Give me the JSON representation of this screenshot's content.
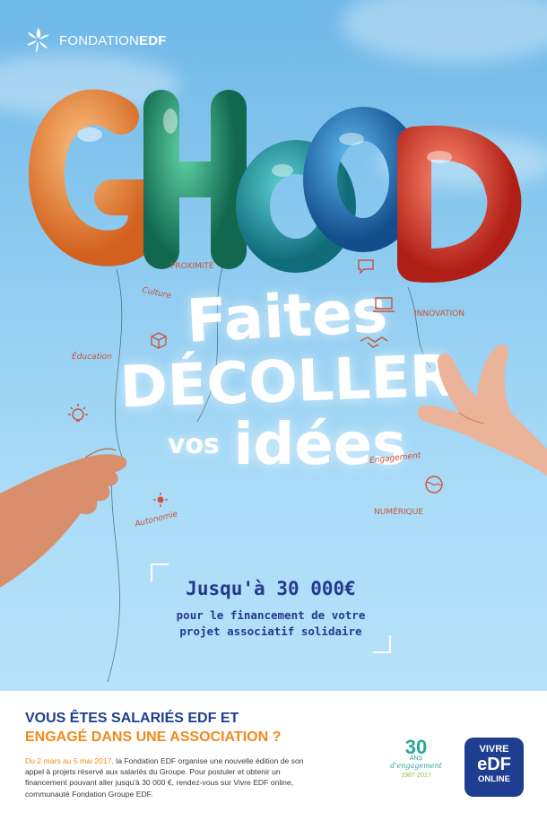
{
  "brand": {
    "logo_main": "FONDATION",
    "logo_accent": "EDF"
  },
  "headline": {
    "balloon_word": "GHOOD",
    "line1": "Faites",
    "line2": "DÉCOLLER",
    "line3_small": "vos",
    "line3_big": "idées"
  },
  "doodles": {
    "proximite": "PROXIMITÉ",
    "culture": "Culture",
    "innovation": "INNOVATION",
    "education": "Éducation",
    "engagement": "Engagement",
    "numerique": "NUMÉRIQUE",
    "autonomie": "Autonomie"
  },
  "offer": {
    "amount": "Jusqu'à 30 000€",
    "line1": "pour le financement de votre",
    "line2": "projet associatif solidaire"
  },
  "footer": {
    "title_line1": "VOUS ÊTES SALARIÉS EDF ET",
    "title_line2": "ENGAGÉ DANS UNE ASSOCIATION ?",
    "body_dates": "Du 2 mars au 5 mai 2017,",
    "body_text": " la Fondation EDF organise une nouvelle édition de son appel à projets réservé aux salariés du Groupe. Pour postuler et obtenir un financement pouvant aller jusqu'à 30 000 €, rendez-vous sur Vivre EDF online, communauté Fondation Groupe EDF."
  },
  "badge": {
    "number": "30",
    "ans": "ANS",
    "engagement": "d'engagement",
    "years": "1987-2017"
  },
  "vivre": {
    "line1": "VIVRE",
    "line2": "eDF",
    "line3": "ONLINE"
  },
  "colors": {
    "navy": "#1e3f8f",
    "orange": "#f08a1c",
    "teal": "#2aa69a",
    "balloon_orange": "#e8792e",
    "balloon_green": "#1f8a6a",
    "balloon_blue": "#1b6fa8",
    "balloon_red": "#d8372a"
  },
  "icons": [
    "edf-logo-icon",
    "lightbulb-icon",
    "laptop-icon",
    "handshake-icon",
    "speech-bubble-icon",
    "box-icon",
    "sun-icon",
    "globe-icon"
  ]
}
